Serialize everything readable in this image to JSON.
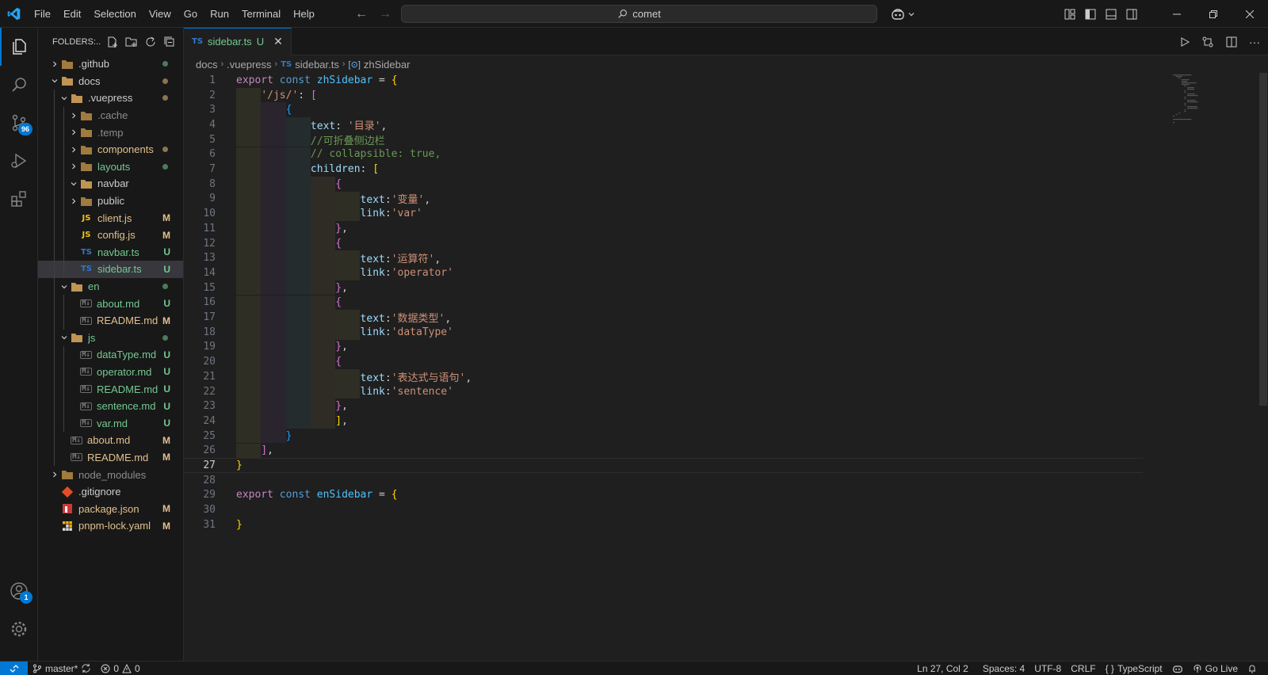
{
  "menu": [
    "File",
    "Edit",
    "Selection",
    "View",
    "Go",
    "Run",
    "Terminal",
    "Help"
  ],
  "search": {
    "text": "comet"
  },
  "activity": {
    "scm_badge": "96",
    "accounts_badge": "1"
  },
  "explorer": {
    "header": "FOLDERS:...",
    "items": [
      {
        "name": ".github",
        "indent": 0,
        "type": "folder",
        "expanded": false,
        "status": "dot",
        "color": "#cccccc"
      },
      {
        "name": "docs",
        "indent": 0,
        "type": "folder",
        "expanded": true,
        "status": "dot-m",
        "color": "#cccccc"
      },
      {
        "name": ".vuepress",
        "indent": 1,
        "type": "folder",
        "expanded": true,
        "status": "dot-m",
        "color": "#cccccc"
      },
      {
        "name": ".cache",
        "indent": 2,
        "type": "folder",
        "expanded": false,
        "status": "",
        "color": "#8c8c8c"
      },
      {
        "name": ".temp",
        "indent": 2,
        "type": "folder",
        "expanded": false,
        "status": "",
        "color": "#8c8c8c"
      },
      {
        "name": "components",
        "indent": 2,
        "type": "folder",
        "expanded": false,
        "status": "dot-m",
        "color": "#e2c08d"
      },
      {
        "name": "layouts",
        "indent": 2,
        "type": "folder",
        "expanded": false,
        "status": "dot",
        "color": "#73c991"
      },
      {
        "name": "navbar",
        "indent": 2,
        "type": "folder",
        "expanded": true,
        "status": "",
        "color": "#cccccc"
      },
      {
        "name": "public",
        "indent": 2,
        "type": "folder",
        "expanded": false,
        "status": "",
        "color": "#cccccc"
      },
      {
        "name": "client.js",
        "indent": 2,
        "type": "js",
        "status": "M",
        "color": "#e2c08d"
      },
      {
        "name": "config.js",
        "indent": 2,
        "type": "js",
        "status": "M",
        "color": "#e2c08d"
      },
      {
        "name": "navbar.ts",
        "indent": 2,
        "type": "ts",
        "status": "U",
        "color": "#73c991"
      },
      {
        "name": "sidebar.ts",
        "indent": 2,
        "type": "ts",
        "status": "U",
        "color": "#73c991",
        "selected": true
      },
      {
        "name": "en",
        "indent": 1,
        "type": "folder",
        "expanded": true,
        "status": "dot",
        "color": "#73c991"
      },
      {
        "name": "about.md",
        "indent": 2,
        "type": "md",
        "status": "U",
        "color": "#73c991"
      },
      {
        "name": "README.md",
        "indent": 2,
        "type": "md",
        "status": "M",
        "color": "#e2c08d"
      },
      {
        "name": "js",
        "indent": 1,
        "type": "folder",
        "expanded": true,
        "status": "dot",
        "color": "#73c991"
      },
      {
        "name": "dataType.md",
        "indent": 2,
        "type": "md",
        "status": "U",
        "color": "#73c991"
      },
      {
        "name": "operator.md",
        "indent": 2,
        "type": "md",
        "status": "U",
        "color": "#73c991"
      },
      {
        "name": "README.md",
        "indent": 2,
        "type": "md",
        "status": "U",
        "color": "#73c991"
      },
      {
        "name": "sentence.md",
        "indent": 2,
        "type": "md",
        "status": "U",
        "color": "#73c991"
      },
      {
        "name": "var.md",
        "indent": 2,
        "type": "md",
        "status": "U",
        "color": "#73c991"
      },
      {
        "name": "about.md",
        "indent": 1,
        "type": "md",
        "status": "M",
        "color": "#e2c08d"
      },
      {
        "name": "README.md",
        "indent": 1,
        "type": "md",
        "status": "M",
        "color": "#e2c08d"
      },
      {
        "name": "node_modules",
        "indent": 0,
        "type": "folder",
        "expanded": false,
        "status": "",
        "color": "#8c8c8c"
      },
      {
        "name": ".gitignore",
        "indent": 0,
        "type": "git",
        "status": "",
        "color": "#cccccc"
      },
      {
        "name": "package.json",
        "indent": 0,
        "type": "npm",
        "status": "M",
        "color": "#e2c08d"
      },
      {
        "name": "pnpm-lock.yaml",
        "indent": 0,
        "type": "pnpm",
        "status": "M",
        "color": "#e2c08d"
      }
    ]
  },
  "tab": {
    "icon": "TS",
    "label": "sidebar.ts",
    "status": "U"
  },
  "breadcrumb": [
    "docs",
    ".vuepress",
    "sidebar.ts",
    "zhSidebar"
  ],
  "code": {
    "current_line": 27,
    "lines": [
      [
        [
          "export ",
          "k"
        ],
        [
          "const ",
          "kw"
        ],
        [
          "zhSidebar",
          "vr"
        ],
        [
          " = ",
          "punc"
        ],
        [
          "{",
          "p1"
        ]
      ],
      [
        [
          "    ",
          "punc"
        ],
        [
          "'/js/'",
          "str"
        ],
        [
          ": ",
          "punc"
        ],
        [
          "[",
          "p2"
        ]
      ],
      [
        [
          "        ",
          "punc"
        ],
        [
          "{",
          "p3"
        ]
      ],
      [
        [
          "            ",
          "punc"
        ],
        [
          "text",
          "var"
        ],
        [
          ": ",
          "punc"
        ],
        [
          "'目录'",
          "str"
        ],
        [
          ",",
          "punc"
        ]
      ],
      [
        [
          "            ",
          "punc"
        ],
        [
          "//可折叠侧边栏",
          "cmt"
        ]
      ],
      [
        [
          "            ",
          "punc"
        ],
        [
          "// collapsible: true,",
          "cmt"
        ]
      ],
      [
        [
          "            ",
          "punc"
        ],
        [
          "children",
          "var"
        ],
        [
          ": ",
          "punc"
        ],
        [
          "[",
          "p1"
        ]
      ],
      [
        [
          "                ",
          "punc"
        ],
        [
          "{",
          "p2"
        ]
      ],
      [
        [
          "                    ",
          "punc"
        ],
        [
          "text",
          "var"
        ],
        [
          ":",
          "punc"
        ],
        [
          "'变量'",
          "str"
        ],
        [
          ",",
          "punc"
        ]
      ],
      [
        [
          "                    ",
          "punc"
        ],
        [
          "link",
          "var"
        ],
        [
          ":",
          "punc"
        ],
        [
          "'var'",
          "str"
        ]
      ],
      [
        [
          "                ",
          "punc"
        ],
        [
          "}",
          "p2"
        ],
        [
          ",",
          "punc"
        ]
      ],
      [
        [
          "                ",
          "punc"
        ],
        [
          "{",
          "p2"
        ]
      ],
      [
        [
          "                    ",
          "punc"
        ],
        [
          "text",
          "var"
        ],
        [
          ":",
          "punc"
        ],
        [
          "'运算符'",
          "str"
        ],
        [
          ",",
          "punc"
        ]
      ],
      [
        [
          "                    ",
          "punc"
        ],
        [
          "link",
          "var"
        ],
        [
          ":",
          "punc"
        ],
        [
          "'operator'",
          "str"
        ]
      ],
      [
        [
          "                ",
          "punc"
        ],
        [
          "}",
          "p2"
        ],
        [
          ",",
          "punc"
        ]
      ],
      [
        [
          "                ",
          "punc"
        ],
        [
          "{",
          "p2"
        ]
      ],
      [
        [
          "                    ",
          "punc"
        ],
        [
          "text",
          "var"
        ],
        [
          ":",
          "punc"
        ],
        [
          "'数据类型'",
          "str"
        ],
        [
          ",",
          "punc"
        ]
      ],
      [
        [
          "                    ",
          "punc"
        ],
        [
          "link",
          "var"
        ],
        [
          ":",
          "punc"
        ],
        [
          "'dataType'",
          "str"
        ]
      ],
      [
        [
          "                ",
          "punc"
        ],
        [
          "}",
          "p2"
        ],
        [
          ",",
          "punc"
        ]
      ],
      [
        [
          "                ",
          "punc"
        ],
        [
          "{",
          "p2"
        ]
      ],
      [
        [
          "                    ",
          "punc"
        ],
        [
          "text",
          "var"
        ],
        [
          ":",
          "punc"
        ],
        [
          "'表达式与语句'",
          "str"
        ],
        [
          ",",
          "punc"
        ]
      ],
      [
        [
          "                    ",
          "punc"
        ],
        [
          "link",
          "var"
        ],
        [
          ":",
          "punc"
        ],
        [
          "'sentence'",
          "str"
        ]
      ],
      [
        [
          "                ",
          "punc"
        ],
        [
          "}",
          "p2"
        ],
        [
          ",",
          "punc"
        ]
      ],
      [
        [
          "                ",
          "punc"
        ],
        [
          "]",
          "p1"
        ],
        [
          ",",
          "punc"
        ]
      ],
      [
        [
          "        ",
          "punc"
        ],
        [
          "}",
          "p3"
        ]
      ],
      [
        [
          "    ",
          "punc"
        ],
        [
          "]",
          "p2"
        ],
        [
          ",",
          "punc"
        ]
      ],
      [
        [
          "}",
          "p1"
        ]
      ],
      [
        [
          "",
          "punc"
        ]
      ],
      [
        [
          "export ",
          "k"
        ],
        [
          "const ",
          "kw"
        ],
        [
          "enSidebar",
          "vr"
        ],
        [
          " = ",
          "punc"
        ],
        [
          "{",
          "p1"
        ]
      ],
      [
        [
          "",
          "punc"
        ]
      ],
      [
        [
          "}",
          "p1"
        ]
      ]
    ]
  },
  "statusbar": {
    "branch": "master*",
    "errors": "0",
    "warnings": "0",
    "position": "Ln 27, Col 2",
    "spaces": "Spaces: 4",
    "encoding": "UTF-8",
    "eol": "CRLF",
    "language": "TypeScript",
    "golive": "Go Live"
  }
}
